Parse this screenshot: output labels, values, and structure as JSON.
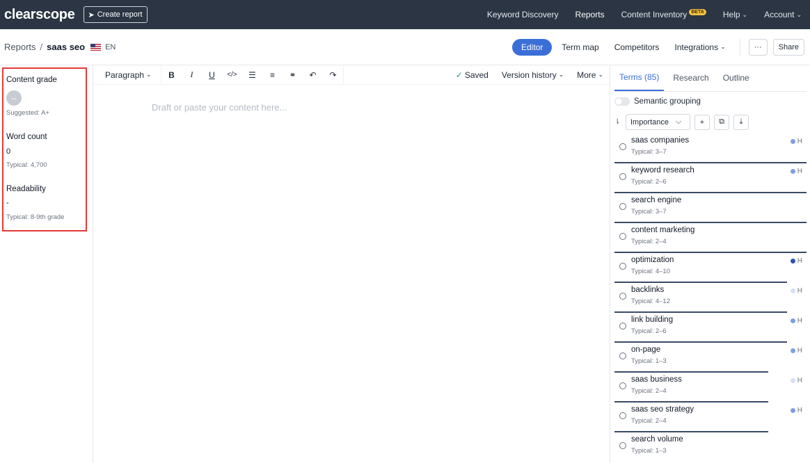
{
  "topbar": {
    "logo": "clearscope",
    "create_report": "Create report",
    "nav": [
      {
        "label": "Keyword Discovery",
        "dropdown": false
      },
      {
        "label": "Reports",
        "dropdown": false
      },
      {
        "label": "Content Inventory",
        "badge": "BETA",
        "dropdown": false
      },
      {
        "label": "Help",
        "dropdown": true
      },
      {
        "label": "Account",
        "dropdown": true
      }
    ]
  },
  "subbar": {
    "breadcrumb_root": "Reports",
    "breadcrumb_sep": "/",
    "breadcrumb_current": "saas seo",
    "language": "EN",
    "editor": "Editor",
    "term_map": "Term map",
    "competitors": "Competitors",
    "integrations": "Integrations",
    "more": "···",
    "share": "Share"
  },
  "metrics": {
    "content_grade_title": "Content grade",
    "content_grade_value": "–",
    "content_grade_suggested": "Suggested: A+",
    "word_count_title": "Word count",
    "word_count_value": "0",
    "word_count_typical": "Typical: 4,700",
    "readability_title": "Readability",
    "readability_value": "-",
    "readability_typical": "Typical: 8-9th grade"
  },
  "toolbar": {
    "paragraph": "Paragraph",
    "saved": "Saved",
    "version_history": "Version history",
    "more": "More"
  },
  "editor": {
    "placeholder": "Draft or paste your content here..."
  },
  "panel": {
    "tabs": [
      "Terms (85)",
      "Research",
      "Outline"
    ],
    "semantic_grouping": "Semantic grouping",
    "sort_value": "Importance",
    "terms": [
      {
        "name": "saas companies",
        "typical": "Typical: 3–7",
        "importance": "H",
        "dot_color": "#7f9ee8",
        "bar_pct": 100
      },
      {
        "name": "keyword research",
        "typical": "Typical: 2–6",
        "importance": "H",
        "dot_color": "#7f9ee8",
        "bar_pct": 100
      },
      {
        "name": "search engine",
        "typical": "Typical: 3–7",
        "importance": "",
        "dot_color": "",
        "bar_pct": 100
      },
      {
        "name": "content marketing",
        "typical": "Typical: 2–4",
        "importance": "",
        "dot_color": "",
        "bar_pct": 100
      },
      {
        "name": "optimization",
        "typical": "Typical: 4–10",
        "importance": "H",
        "dot_color": "#2f4fbf",
        "bar_pct": 90
      },
      {
        "name": "backlinks",
        "typical": "Typical: 4–12",
        "importance": "H",
        "dot_color": "#d6defa",
        "bar_pct": 90
      },
      {
        "name": "link building",
        "typical": "Typical: 2–6",
        "importance": "H",
        "dot_color": "#7f9ee8",
        "bar_pct": 90
      },
      {
        "name": "on-page",
        "typical": "Typical: 1–3",
        "importance": "H",
        "dot_color": "#7f9ee8",
        "bar_pct": 80
      },
      {
        "name": "saas business",
        "typical": "Typical: 2–4",
        "importance": "H",
        "dot_color": "#d6defa",
        "bar_pct": 80
      },
      {
        "name": "saas seo strategy",
        "typical": "Typical: 2–4",
        "importance": "H",
        "dot_color": "#7f9ee8",
        "bar_pct": 80
      },
      {
        "name": "search volume",
        "typical": "Typical: 1–3",
        "importance": "",
        "dot_color": "",
        "bar_pct": 0
      }
    ]
  }
}
